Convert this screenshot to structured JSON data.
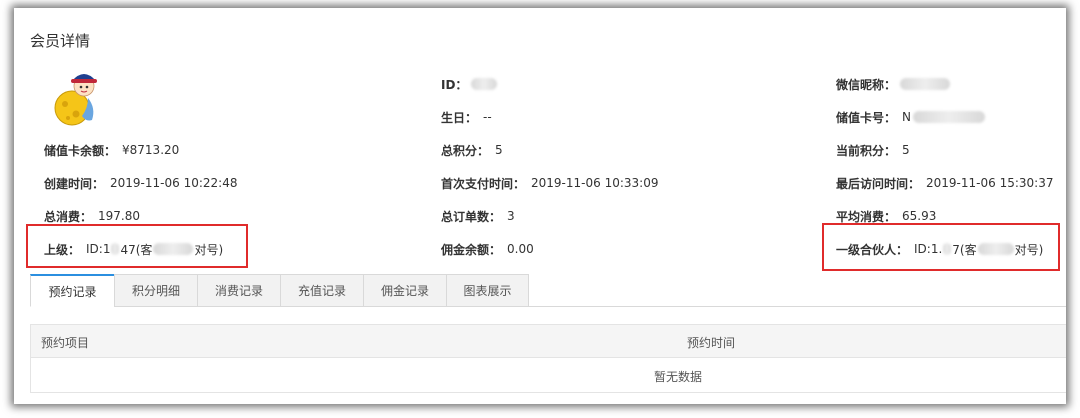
{
  "page_title": "会员详情",
  "avatar": {
    "icon": "cartoon-avatar-icon"
  },
  "fields": {
    "id": {
      "label": "ID：",
      "value": ""
    },
    "wechat_nickname": {
      "label": "微信昵称：",
      "value": ""
    },
    "birthday": {
      "label": "生日：",
      "value": "--"
    },
    "card_number": {
      "label": "储值卡号：",
      "value": "N"
    },
    "card_balance": {
      "label": "储值卡余额：",
      "value": "¥8713.20"
    },
    "total_points": {
      "label": "总积分：",
      "value": "5"
    },
    "current_points": {
      "label": "当前积分：",
      "value": "5"
    },
    "created_time": {
      "label": "创建时间：",
      "value": "2019-11-06 10:22:48"
    },
    "first_pay_time": {
      "label": "首次支付时间：",
      "value": "2019-11-06 10:33:09"
    },
    "last_visit_time": {
      "label": "最后访问时间：",
      "value": "2019-11-06 15:30:37"
    },
    "total_spend": {
      "label": "总消费：",
      "value": "197.80"
    },
    "total_orders": {
      "label": "总订单数：",
      "value": "3"
    },
    "avg_spend": {
      "label": "平均消费：",
      "value": "65.93"
    },
    "superior": {
      "label": "上级：",
      "value_prefix": "ID:1",
      "value_mid": "47(客",
      "value_suffix": "对号)"
    },
    "commission_balance": {
      "label": "佣金余额：",
      "value": "0.00"
    },
    "first_partner": {
      "label": "一级合伙人：",
      "value_prefix": "ID:1.",
      "value_mid": "7(客",
      "value_suffix": "对号)"
    }
  },
  "tabs": [
    {
      "label": "预约记录",
      "active": true
    },
    {
      "label": "积分明细",
      "active": false
    },
    {
      "label": "消费记录",
      "active": false
    },
    {
      "label": "充值记录",
      "active": false
    },
    {
      "label": "佣金记录",
      "active": false
    },
    {
      "label": "图表展示",
      "active": false
    }
  ],
  "table": {
    "headers": [
      "预约项目",
      "预约时间"
    ],
    "empty_text": "暂无数据"
  },
  "colors": {
    "highlight_box": "#e02b2b",
    "tab_accent": "#2b8fe0"
  }
}
